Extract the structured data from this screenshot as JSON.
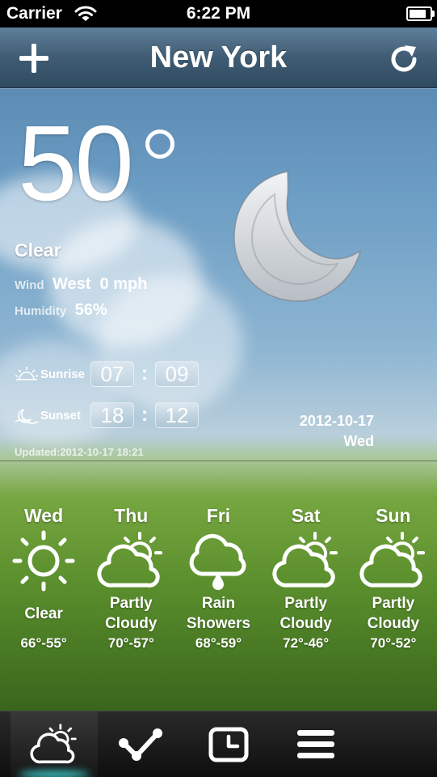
{
  "status_bar": {
    "carrier": "Carrier",
    "time": "6:22 PM",
    "battery_level": 0.85
  },
  "nav": {
    "title": "New York",
    "add_icon": "plus-icon",
    "refresh_icon": "refresh-icon"
  },
  "current": {
    "temperature": "50",
    "condition": "Clear",
    "condition_icon": "moon-icon",
    "wind_label": "Wind",
    "wind_value": "West  0 mph",
    "humidity_label": "Humidity",
    "humidity_value": "56%",
    "sunrise_label": "Sunrise",
    "sunrise_hour": "07",
    "sunrise_minute": "09",
    "sunset_label": "Sunset",
    "sunset_hour": "18",
    "sunset_minute": "12",
    "date": "2012-10-17",
    "weekday": "Wed",
    "updated": "Updated:2012-10-17 18:21"
  },
  "forecast": [
    {
      "day": "Wed",
      "condition": "Clear",
      "range": "66°-55°",
      "icon": "sun-icon"
    },
    {
      "day": "Thu",
      "condition": "Partly Cloudy",
      "range": "70°-57°",
      "icon": "partly-cloudy-icon"
    },
    {
      "day": "Fri",
      "condition": "Rain Showers",
      "range": "68°-59°",
      "icon": "rain-icon"
    },
    {
      "day": "Sat",
      "condition": "Partly Cloudy",
      "range": "72°-46°",
      "icon": "partly-cloudy-icon"
    },
    {
      "day": "Sun",
      "condition": "Partly Cloudy",
      "range": "70°-52°",
      "icon": "partly-cloudy-icon"
    }
  ],
  "tabs": [
    {
      "icon": "weather-icon",
      "active": true
    },
    {
      "icon": "chart-icon",
      "active": false
    },
    {
      "icon": "clock-icon",
      "active": false
    },
    {
      "icon": "menu-icon",
      "active": false
    }
  ],
  "colors": {
    "tab_glow": "#3fe6e6",
    "nav_bar": "#3f5c74"
  }
}
